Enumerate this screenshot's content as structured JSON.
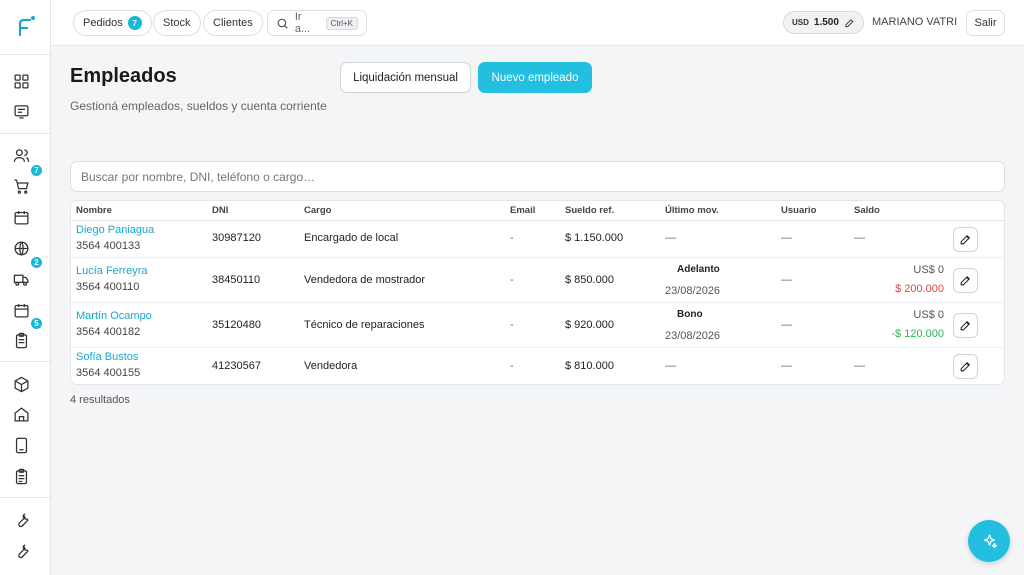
{
  "colors": {
    "accent": "#22bfe0",
    "link": "#17a9cf",
    "negative": "#e04545",
    "positive": "#2db35c"
  },
  "sidebar": {
    "icons": [
      "dashboard-icon",
      "receipt-icon",
      "users-icon",
      "cart-icon",
      "calendar-icon",
      "globe-icon",
      "truck-icon",
      "calendar-icon",
      "clipboard-icon",
      "box-icon",
      "store-icon",
      "tablet-icon",
      "clipboard-list-icon",
      "wrench-icon",
      "wrench-icon"
    ],
    "badges": {
      "cart": "7",
      "truck": "2",
      "clipboard": "5"
    }
  },
  "topbar": {
    "pedidos_label": "Pedidos",
    "pedidos_badge": "7",
    "stock_label": "Stock",
    "clientes_label": "Clientes",
    "search_label": "Ir a...",
    "search_shortcut": "Ctrl+K",
    "currency_code": "USD",
    "currency_value": "1.500",
    "user_name": "MARIANO VATRI",
    "logout_label": "Salir"
  },
  "header": {
    "title": "Empleados",
    "subtitle": "Gestioná empleados, sueldos y cuenta corriente",
    "btn_liquidacion": "Liquidación mensual",
    "btn_nuevo": "Nuevo empleado"
  },
  "search": {
    "placeholder": "Buscar por nombre, DNI, teléfono o cargo…"
  },
  "table": {
    "columns": [
      "Nombre",
      "DNI",
      "Cargo",
      "Email",
      "Sueldo ref.",
      "Último mov.",
      "Usuario",
      "Saldo"
    ],
    "rows": [
      {
        "name": "Diego Paniagua",
        "phone": "3564 400133",
        "dni": "30987120",
        "cargo": "Encargado de local",
        "email": "-",
        "sueldo": "$ 1.150.000",
        "mov_type": "",
        "mov_date": "—",
        "usuario": "—",
        "saldo_usd": "",
        "saldo": "—"
      },
      {
        "name": "Lucía Ferreyra",
        "phone": "3564 400110",
        "dni": "38450110",
        "cargo": "Vendedora de mostrador",
        "email": "-",
        "sueldo": "$ 850.000",
        "mov_type": "Adelanto",
        "mov_date": "23/08/2026",
        "usuario": "—",
        "saldo_usd": "US$ 0",
        "saldo": "$ 200.000"
      },
      {
        "name": "Martín Ocampo",
        "phone": "3564 400182",
        "dni": "35120480",
        "cargo": "Técnico de reparaciones",
        "email": "-",
        "sueldo": "$ 920.000",
        "mov_type": "Bono",
        "mov_date": "23/08/2026",
        "usuario": "—",
        "saldo_usd": "US$ 0",
        "saldo": "-$ 120.000"
      },
      {
        "name": "Sofía Bustos",
        "phone": "3564 400155",
        "dni": "41230567",
        "cargo": "Vendedora",
        "email": "-",
        "sueldo": "$ 810.000",
        "mov_type": "",
        "mov_date": "—",
        "usuario": "—",
        "saldo_usd": "",
        "saldo": "—"
      }
    ]
  },
  "results_label": "4 resultados"
}
